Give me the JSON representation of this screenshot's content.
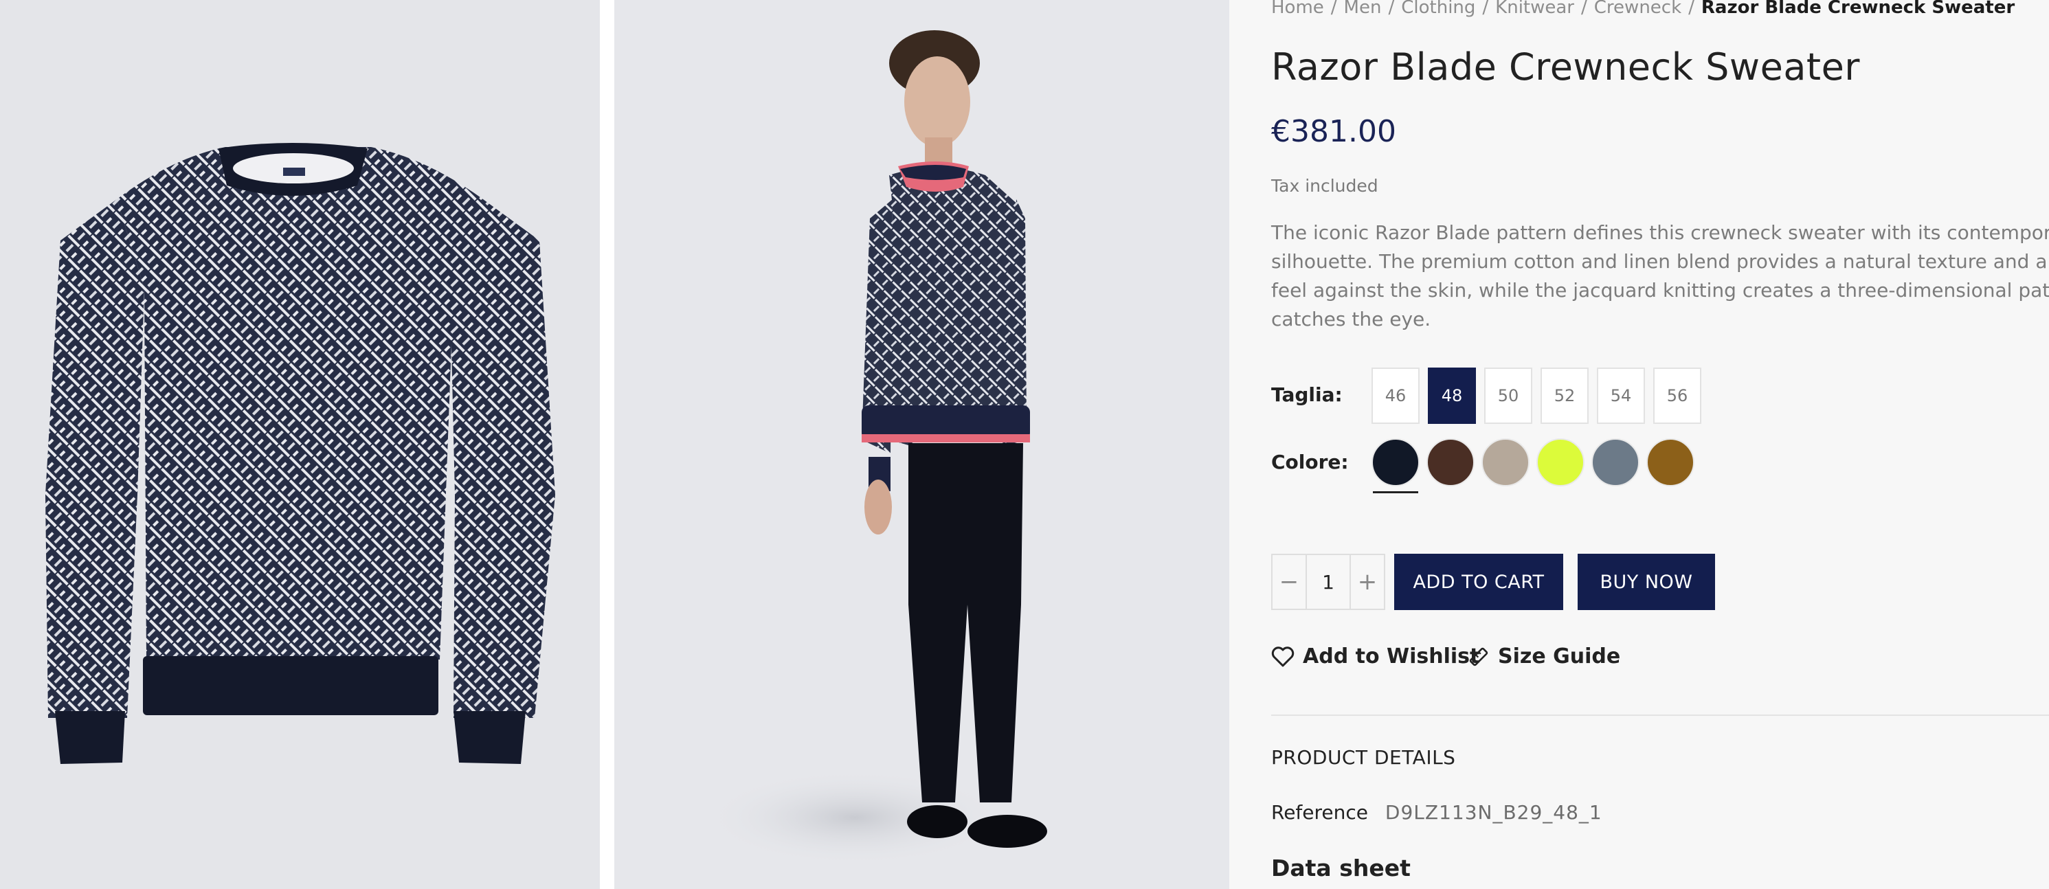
{
  "breadcrumb": {
    "items": [
      "Home",
      "Men",
      "Clothing",
      "Knitwear",
      "Crewneck"
    ],
    "current": "Razor Blade Crewneck Sweater",
    "separator": "/"
  },
  "product": {
    "title": "Razor Blade Crewneck Sweater",
    "price": "€381.00",
    "tax_note": "Tax included",
    "description_lines": [
      "The iconic Razor Blade pattern defines this crewneck sweater with its contemporary",
      "silhouette. The premium cotton and linen blend provides a natural texture and a pl",
      "feel against the skin, while the jacquard knitting creates a three-dimensional patte",
      "catches the eye."
    ]
  },
  "options": {
    "size_label": "Taglia:",
    "sizes": [
      "46",
      "48",
      "50",
      "52",
      "54",
      "56"
    ],
    "selected_size": "48",
    "color_label": "Colore:",
    "colors": [
      "#111827",
      "#4a2e24",
      "#b5a89a",
      "#dcfb3a",
      "#6c7a88",
      "#8c6019"
    ],
    "selected_color_index": 0
  },
  "cart": {
    "quantity": "1",
    "minus": "−",
    "plus": "+",
    "add_to_cart_label": "ADD TO CART",
    "buy_now_label": "BUY NOW"
  },
  "links": {
    "wishlist": "Add to Wishlist",
    "size_guide": "Size Guide"
  },
  "details": {
    "heading": "PRODUCT DETAILS",
    "reference_label": "Reference",
    "reference_value": "D9LZ113N_B29_48_1",
    "data_sheet": "Data sheet"
  },
  "icons": {
    "wishlist": "heart-icon",
    "size_guide": "ruler-icon"
  },
  "theme": {
    "navy": "#131e4e",
    "price_color": "#1a2356"
  }
}
